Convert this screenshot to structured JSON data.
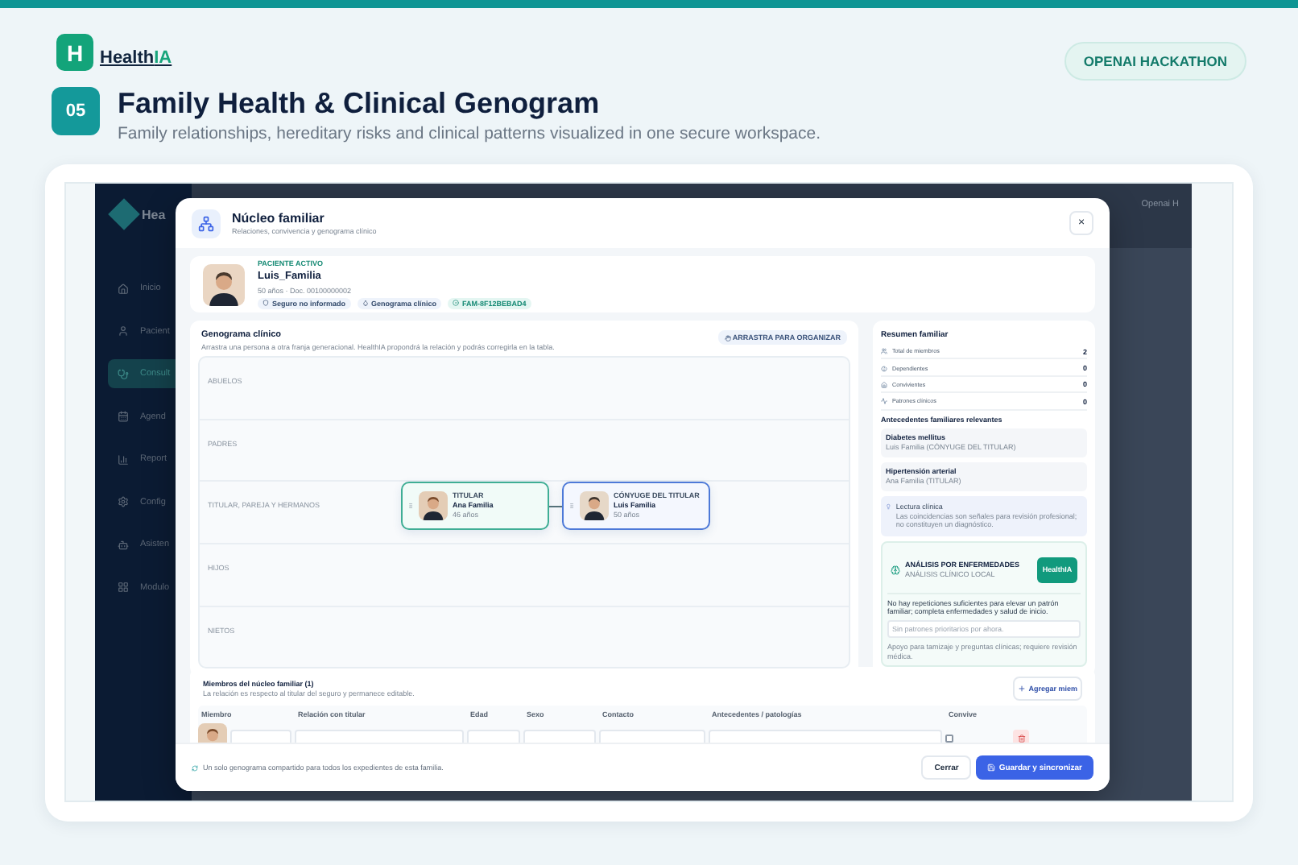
{
  "brand": {
    "mark": "H",
    "name": "Health",
    "accent": "IA"
  },
  "badge": "OPENAI HACKATHON",
  "step": "05",
  "title": "Family Health & Clinical Genogram",
  "subtitle": "Family relationships, hereditary risks and clinical patterns visualized in one secure workspace.",
  "app": {
    "logo": "Hea",
    "topbar_text": "Openai H",
    "sidebar": [
      {
        "label": "Inicio",
        "selected": false
      },
      {
        "label": "Pacient",
        "selected": false
      },
      {
        "label": "Consult",
        "selected": true
      },
      {
        "label": "Agend",
        "selected": false
      },
      {
        "label": "Report",
        "selected": false
      },
      {
        "label": "Config",
        "selected": false
      },
      {
        "label": "Asisten",
        "selected": false
      },
      {
        "label": "Modulo",
        "selected": false
      }
    ]
  },
  "modal": {
    "title": "Núcleo familiar",
    "subtitle": "Relaciones, convivencia y genograma clínico",
    "close": "×",
    "patient": {
      "eyebrow": "PACIENTE ACTIVO",
      "name": "Luis_Familia",
      "meta": "50 años · Doc. 00100000002",
      "chips": [
        {
          "label": "Seguro no informado",
          "kind": "plain"
        },
        {
          "label": "Genograma clínico",
          "kind": "plain"
        },
        {
          "label": "FAM-8F12BEBAD4",
          "kind": "code"
        }
      ]
    },
    "genogram": {
      "title": "Genograma clínico",
      "description": "Arrastra una persona a otra franja generacional. HealthIA propondrá la relación y podrás corregirla en la tabla.",
      "action": "ARRASTRA PARA ORGANIZAR",
      "bands": [
        {
          "label": "ABUELOS"
        },
        {
          "label": "PADRES"
        },
        {
          "label": "TITULAR, PAREJA Y HERMANOS"
        },
        {
          "label": "HIJOS"
        },
        {
          "label": "NIETOS"
        }
      ],
      "nodes": [
        {
          "role": "TITULAR",
          "name": "Ana Familia",
          "age": "46 años",
          "kind": "titular"
        },
        {
          "role": "CÓNYUGE DEL TITULAR",
          "name": "Luis Familia",
          "age": "50 años",
          "kind": "spouse"
        }
      ]
    },
    "summary": {
      "title": "Resumen familiar",
      "stats": [
        {
          "label": "Total de miembros",
          "value": "2"
        },
        {
          "label": "Dependientes",
          "value": "0"
        },
        {
          "label": "Convivientes",
          "value": "0"
        },
        {
          "label": "Patrones clínicos",
          "value": "0"
        }
      ],
      "history_title": "Antecedentes familiares relevantes",
      "history": [
        {
          "condition": "Diabetes mellitus",
          "person": "Luis Familia (CÓNYUGE DEL TITULAR)"
        },
        {
          "condition": "Hipertensión arterial",
          "person": "Ana Familia (TITULAR)"
        }
      ],
      "note": {
        "title": "Lectura clínica",
        "text": "Las coincidencias son señales para revisión profesional; no constituyen un diagnóstico."
      },
      "analysis": {
        "title": "ANÁLISIS POR ENFERMEDADES",
        "tag": "ANÁLISIS CLÍNICO LOCAL",
        "brand": "HealthIA",
        "message": "No hay repeticiones suficientes para elevar un patrón familiar; completa enfermedades y salud de inicio.",
        "placeholder": "Sin patrones prioritarios por ahora.",
        "footnote": "Apoyo para tamizaje y preguntas clínicas; requiere revisión médica."
      }
    },
    "members": {
      "title": "Miembros del núcleo familiar (1)",
      "subtitle": "La relación es respecto al titular del seguro y permanece editable.",
      "add": "Agregar miem",
      "columns": [
        "Miembro",
        "Relación con titular",
        "Edad",
        "Sexo",
        "Contacto",
        "Antecedentes / patologías",
        "Convive"
      ],
      "rows": [
        {
          "convive": false
        }
      ]
    },
    "footer": {
      "note": "Un solo genograma compartido para todos los expedientes de esta familia.",
      "cancel": "Cerrar",
      "save": "Guardar y sincronizar"
    }
  }
}
